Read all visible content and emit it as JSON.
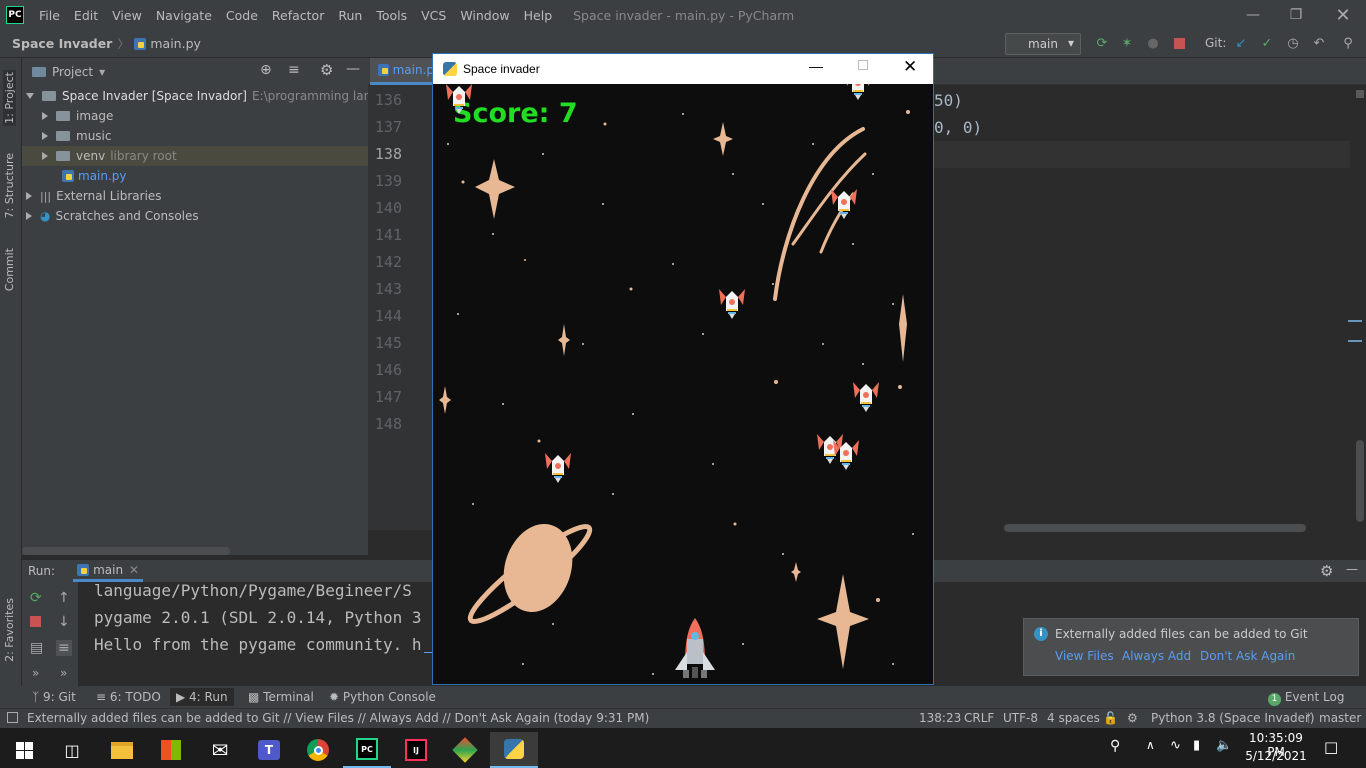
{
  "ide": {
    "window_title": "Space invader - main.py - PyCharm",
    "logo": "PC",
    "menu": [
      "File",
      "Edit",
      "View",
      "Navigate",
      "Code",
      "Refactor",
      "Run",
      "Tools",
      "VCS",
      "Window",
      "Help"
    ],
    "breadcrumb": {
      "project": "Space Invader",
      "file": "main.py"
    },
    "run_config": "main",
    "git_label": "Git:",
    "sidebar_left": {
      "project": "1: Project",
      "structure": "7: Structure",
      "commit": "Commit",
      "favorites": "2: Favorites"
    },
    "project_panel": {
      "title": "Project",
      "root_name": "Space Invader [Space Invador]",
      "root_path": "E:\\programming language",
      "items": [
        {
          "label": "image",
          "type": "folder"
        },
        {
          "label": "music",
          "type": "folder"
        },
        {
          "label": "venv",
          "type": "folder",
          "note": "library root"
        },
        {
          "label": "main.py",
          "type": "file"
        }
      ],
      "external": "External Libraries",
      "scratches": "Scratches and Consoles"
    },
    "editor": {
      "tab": "main.p",
      "line_numbers": [
        "136",
        "137",
        "138",
        "139",
        "140",
        "141",
        "142",
        "143",
        "144",
        "145",
        "146",
        "147",
        "148"
      ],
      "visible_code": [
        "50)",
        "0, 0)"
      ]
    },
    "run_panel": {
      "label": "Run:",
      "tab": "main",
      "lines": [
        " language/Python/Pygame/Begineer/S",
        "pygame 2.0.1 (SDL 2.0.14, Python 3",
        "Hello from the pygame community. h"
      ]
    },
    "notification": {
      "text": "Externally added files can be added to Git",
      "actions": [
        "View Files",
        "Always Add",
        "Don't Ask Again"
      ]
    },
    "bottom_tools": [
      {
        "label": "9: Git"
      },
      {
        "label": "6: TODO"
      },
      {
        "label": "4: Run"
      },
      {
        "label": "Terminal"
      },
      {
        "label": "Python Console"
      }
    ],
    "event_log": "Event Log",
    "event_count": "1",
    "status": {
      "message": "Externally added files can be added to Git // View Files // Always Add // Don't Ask Again (today 9:31 PM)",
      "position": "138:23",
      "line_sep": "CRLF",
      "encoding": "UTF-8",
      "indent": "4 spaces",
      "interpreter": "Python 3.8 (Space Invader)",
      "branch": "master"
    }
  },
  "game": {
    "title": "Space invader",
    "score_text": "Score: 7"
  },
  "taskbar": {
    "time": "10:35:09 PM",
    "date": "5/12/2021"
  },
  "colors": {
    "accent": "#589df6",
    "score": "#22dd22",
    "ide_bg": "#2b2b2b",
    "panel": "#3c3f41"
  }
}
